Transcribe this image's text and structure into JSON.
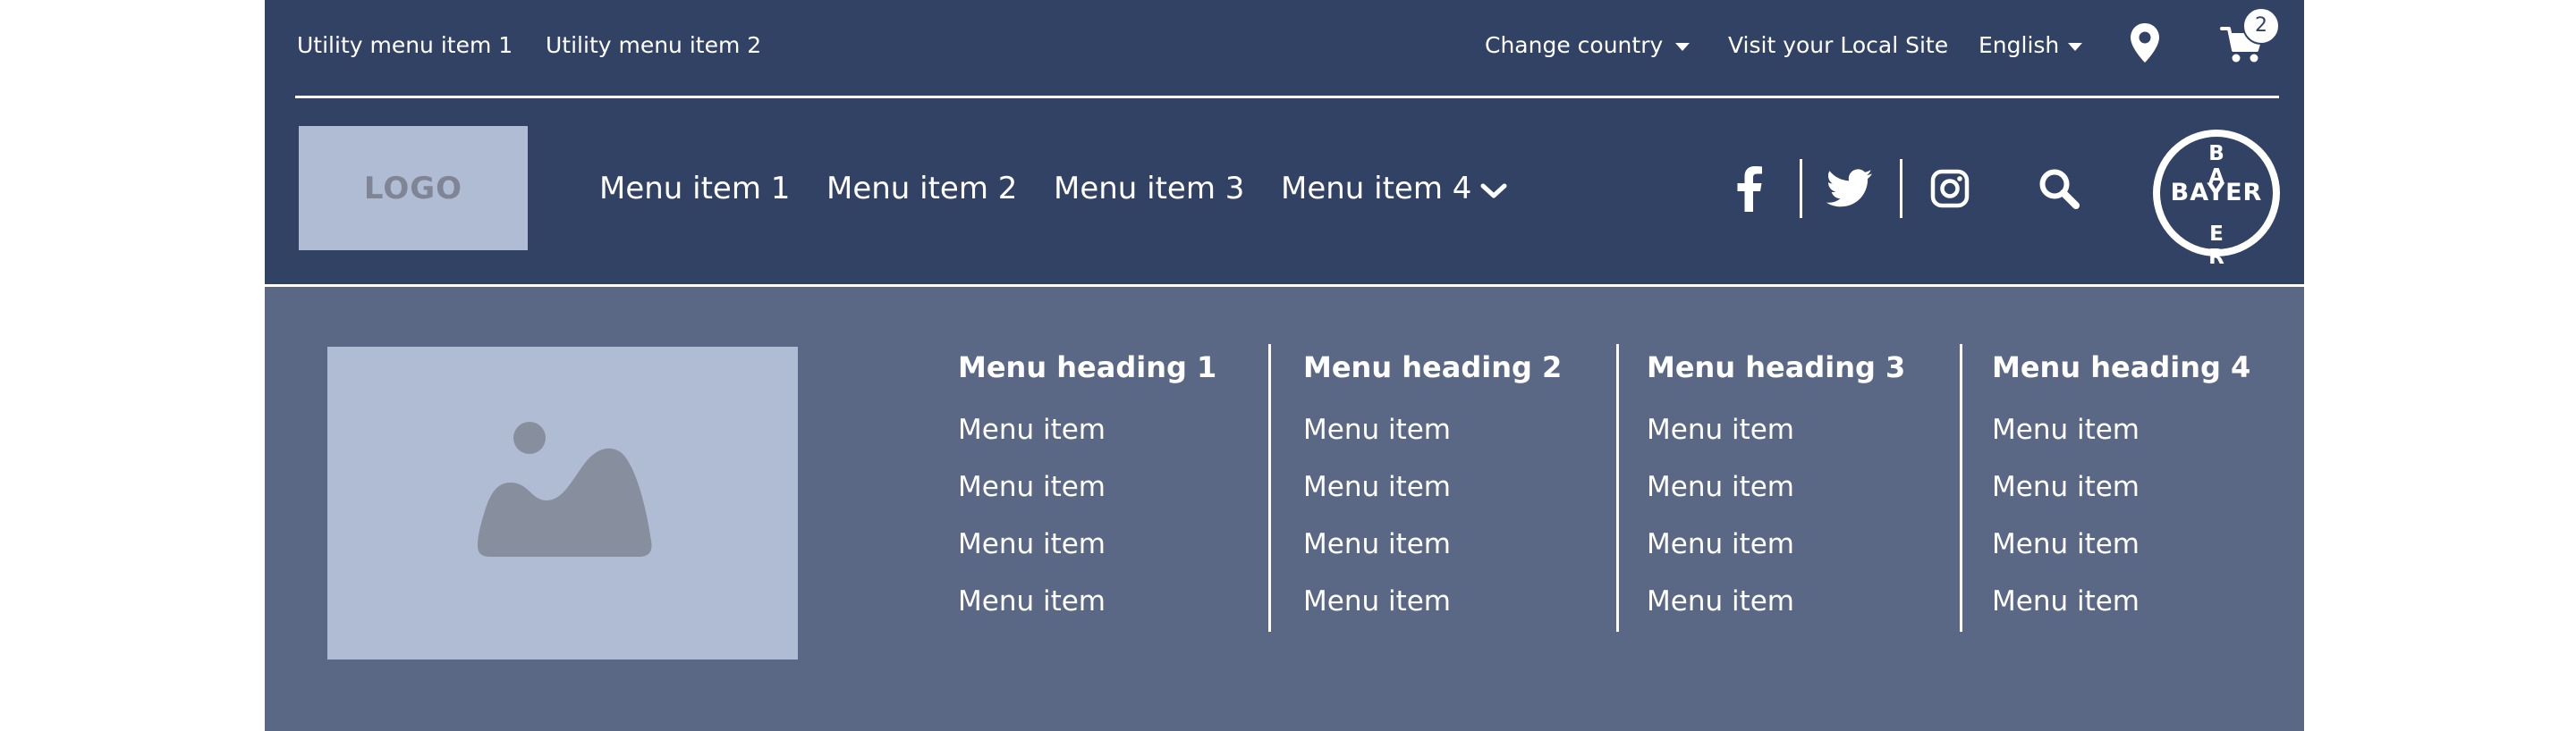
{
  "utility": {
    "left_items": [
      "Utility menu item 1",
      "Utility menu item 2"
    ],
    "change_country": "Change country",
    "visit_local": "Visit your Local Site",
    "language": "English",
    "cart_count": "2"
  },
  "header": {
    "logo_text": "LOGO",
    "nav": [
      "Menu item 1",
      "Menu item 2",
      "Menu item 3",
      "Menu item 4"
    ],
    "social_icons": [
      "facebook-icon",
      "twitter-icon",
      "instagram-icon"
    ],
    "brand": {
      "horizontal": "BAYER",
      "vertical_top": [
        "B",
        "A"
      ],
      "vertical_bottom": [
        "E",
        "R"
      ]
    }
  },
  "mega_menu": {
    "image_icon": "image-placeholder-icon",
    "columns": [
      {
        "heading": "Menu heading 1",
        "items": [
          "Menu item",
          "Menu item",
          "Menu item",
          "Menu item"
        ]
      },
      {
        "heading": "Menu heading 2",
        "items": [
          "Menu item",
          "Menu item",
          "Menu item",
          "Menu item"
        ]
      },
      {
        "heading": "Menu heading 3",
        "items": [
          "Menu item",
          "Menu item",
          "Menu item",
          "Menu item"
        ]
      },
      {
        "heading": "Menu heading 4",
        "items": [
          "Menu item",
          "Menu item",
          "Menu item",
          "Menu item"
        ]
      }
    ]
  },
  "colors": {
    "header_bg": "#324264",
    "mega_bg": "#5a6886",
    "placeholder": "#b0bcd4",
    "placeholder_icon": "#878f9e",
    "text": "#ffffff"
  }
}
